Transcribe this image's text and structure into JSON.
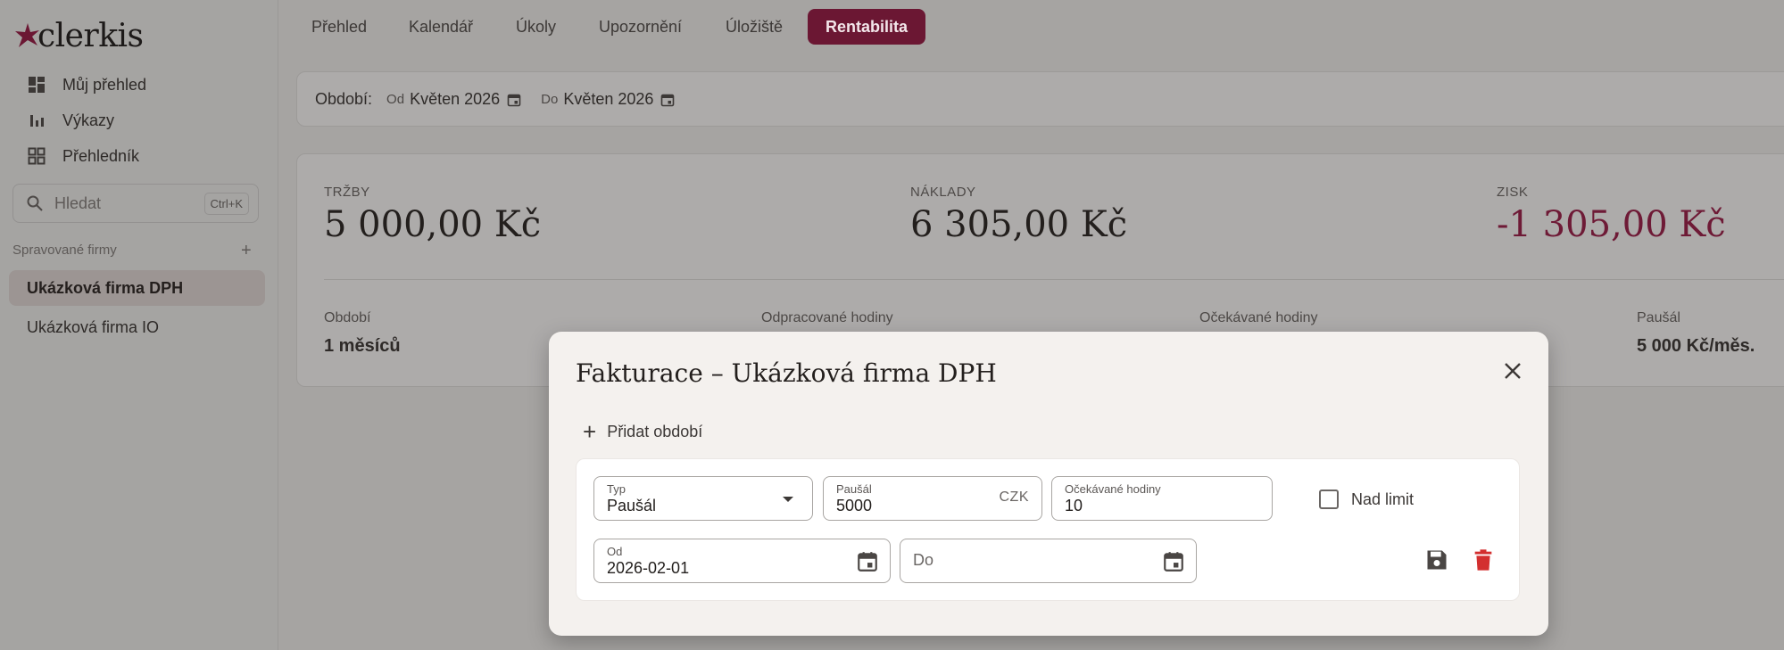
{
  "app": {
    "logo_text": "clerkis"
  },
  "sidebar": {
    "nav": [
      {
        "label": "Můj přehled",
        "icon": "dashboard-icon"
      },
      {
        "label": "Výkazy",
        "icon": "bar-chart-icon"
      },
      {
        "label": "Přehledník",
        "icon": "grid-icon"
      }
    ],
    "search": {
      "placeholder": "Hledat",
      "shortcut": "Ctrl+K"
    },
    "firms_label": "Spravované firmy",
    "firms": [
      {
        "label": "Ukázková firma DPH"
      },
      {
        "label": "Ukázková firma IO"
      }
    ]
  },
  "tabs": [
    {
      "label": "Přehled"
    },
    {
      "label": "Kalendář"
    },
    {
      "label": "Úkoly"
    },
    {
      "label": "Upozornění"
    },
    {
      "label": "Úložiště"
    },
    {
      "label": "Rentabilita"
    }
  ],
  "period": {
    "label": "Období:",
    "from_label": "Od",
    "from_value": "Květen 2026",
    "to_label": "Do",
    "to_value": "Květen 2026"
  },
  "stats": {
    "revenue_label": "TRŽBY",
    "revenue_value": "5 000,00 Kč",
    "costs_label": "NÁKLADY",
    "costs_value": "6 305,00 Kč",
    "profit_label": "ZISK",
    "profit_value": "-1 305,00 Kč",
    "period_label": "Období",
    "period_value": "1 měsíců",
    "worked_hours_label": "Odpracované hodiny",
    "expected_hours_label": "Očekávané hodiny",
    "flat_fee_label": "Paušál",
    "flat_fee_value": "5 000 Kč/měs."
  },
  "modal": {
    "title": "Fakturace – Ukázková firma DPH",
    "add_period_label": "Přidat období",
    "type_label": "Typ",
    "type_value": "Paušál",
    "flat_label": "Paušál",
    "flat_value": "5000",
    "currency": "CZK",
    "expected_label": "Očekávané hodiny",
    "expected_value": "10",
    "over_limit_label": "Nad limit",
    "from_label": "Od",
    "from_value": "2026-02-01",
    "to_placeholder": "Do"
  },
  "colors": {
    "accent": "#6b1733",
    "negative": "#6e1a36",
    "delete": "#d32f2f"
  }
}
